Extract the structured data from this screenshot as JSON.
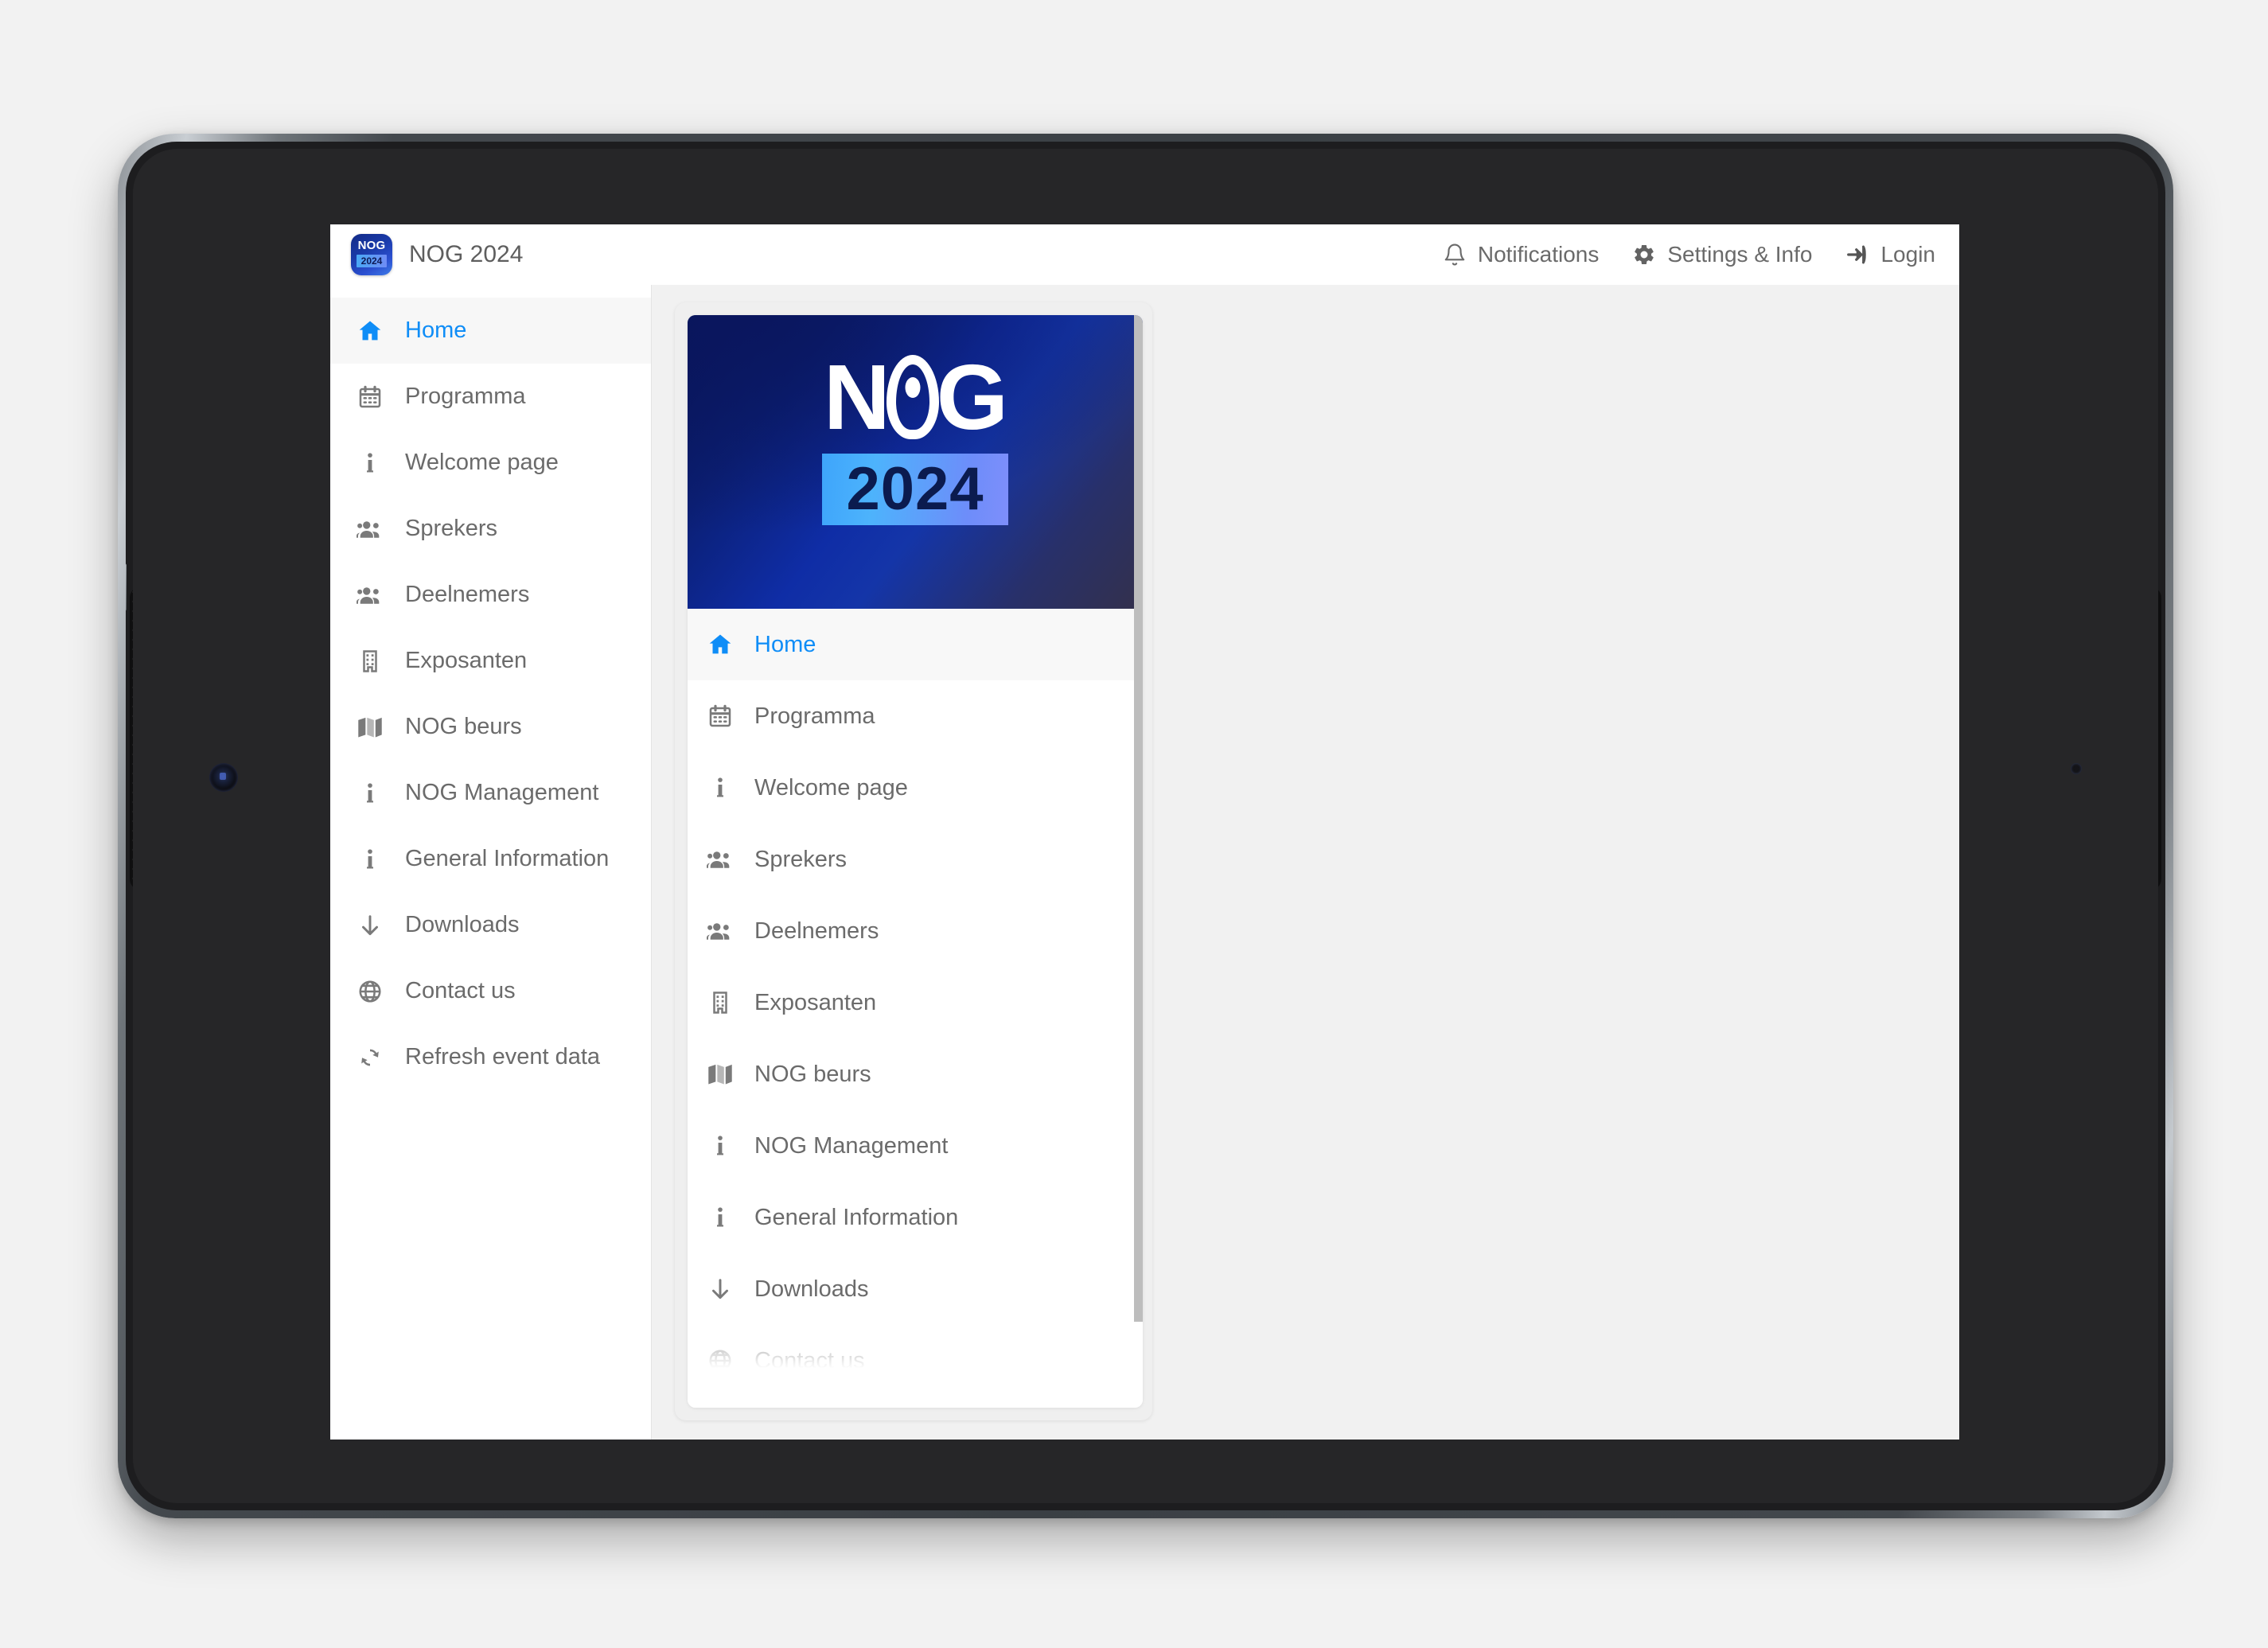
{
  "header": {
    "app_title": "NOG 2024",
    "logo": {
      "top_text": "NOG",
      "year_text": "2024"
    },
    "actions": [
      {
        "icon": "bell-icon",
        "label": "Notifications"
      },
      {
        "icon": "gear-icon",
        "label": "Settings & Info"
      },
      {
        "icon": "login-arrow-icon",
        "label": "Login"
      }
    ]
  },
  "sidebar": {
    "items": [
      {
        "icon": "home-icon",
        "label": "Home",
        "active": true
      },
      {
        "icon": "calendar-icon",
        "label": "Programma",
        "active": false
      },
      {
        "icon": "info-icon",
        "label": "Welcome page",
        "active": false
      },
      {
        "icon": "people-icon",
        "label": "Sprekers",
        "active": false
      },
      {
        "icon": "people-icon",
        "label": "Deelnemers",
        "active": false
      },
      {
        "icon": "building-icon",
        "label": "Exposanten",
        "active": false
      },
      {
        "icon": "map-icon",
        "label": "NOG beurs",
        "active": false
      },
      {
        "icon": "info-icon",
        "label": "NOG Management",
        "active": false
      },
      {
        "icon": "info-icon",
        "label": "General Information",
        "active": false
      },
      {
        "icon": "download-icon",
        "label": "Downloads",
        "active": false
      },
      {
        "icon": "globe-icon",
        "label": "Contact us",
        "active": false
      },
      {
        "icon": "refresh-icon",
        "label": "Refresh event data",
        "active": false
      }
    ]
  },
  "content_card": {
    "hero": {
      "logo_text": "N",
      "logo_text_2": "G",
      "year_text": "2024",
      "gradient_from": "#061456",
      "gradient_to": "#33304c",
      "year_badge_from": "#3ea5fb",
      "year_badge_to": "#7e8efb"
    },
    "menu_items": [
      {
        "icon": "home-icon",
        "label": "Home",
        "active": true
      },
      {
        "icon": "calendar-icon",
        "label": "Programma",
        "active": false
      },
      {
        "icon": "info-icon",
        "label": "Welcome page",
        "active": false
      },
      {
        "icon": "people-icon",
        "label": "Sprekers",
        "active": false
      },
      {
        "icon": "people-icon",
        "label": "Deelnemers",
        "active": false
      },
      {
        "icon": "building-icon",
        "label": "Exposanten",
        "active": false
      },
      {
        "icon": "map-icon",
        "label": "NOG beurs",
        "active": false
      },
      {
        "icon": "info-icon",
        "label": "NOG Management",
        "active": false
      },
      {
        "icon": "info-icon",
        "label": "General Information",
        "active": false
      },
      {
        "icon": "download-icon",
        "label": "Downloads",
        "active": false
      },
      {
        "icon": "globe-icon",
        "label": "Contact us",
        "active": false
      }
    ]
  },
  "theme": {
    "accent": "#0f8df7",
    "text_muted": "#6b6b6b",
    "app_background": "#f1f1f1",
    "panel_background": "#ffffff",
    "scrollbar_thumb": "#bdbdbd"
  }
}
